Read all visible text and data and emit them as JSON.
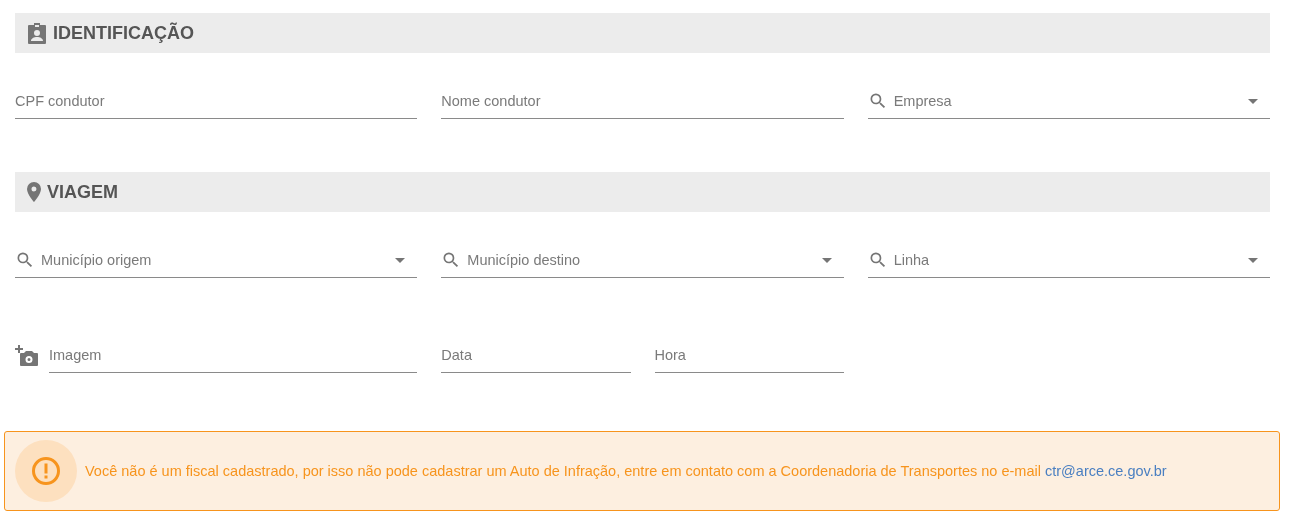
{
  "sections": [
    {
      "title": "IDENTIFICAÇÃO",
      "kind": "badge",
      "rows": [
        [
          {
            "kind": "text",
            "placeholder": "CPF condutor"
          },
          {
            "kind": "text",
            "placeholder": "Nome condutor"
          },
          {
            "kind": "search-select",
            "placeholder": "Empresa"
          }
        ]
      ]
    },
    {
      "title": "VIAGEM",
      "kind": "pin",
      "rows": [
        [
          {
            "kind": "search-select",
            "placeholder": "Município origem"
          },
          {
            "kind": "search-select",
            "placeholder": "Município destino"
          },
          {
            "kind": "search-select",
            "placeholder": "Linha"
          }
        ],
        [
          {
            "kind": "image",
            "placeholder": "Imagem"
          },
          {
            "kind": "short",
            "placeholder": "Data"
          },
          {
            "kind": "short",
            "placeholder": "Hora"
          }
        ]
      ]
    }
  ],
  "alert": {
    "text": "Você não é um fiscal cadastrado, por isso não pode cadastrar um Auto de Infração, entre em contato com a Coordenadoria de Transportes no e-mail",
    "link": "ctr@arce.ce.gov.br"
  }
}
